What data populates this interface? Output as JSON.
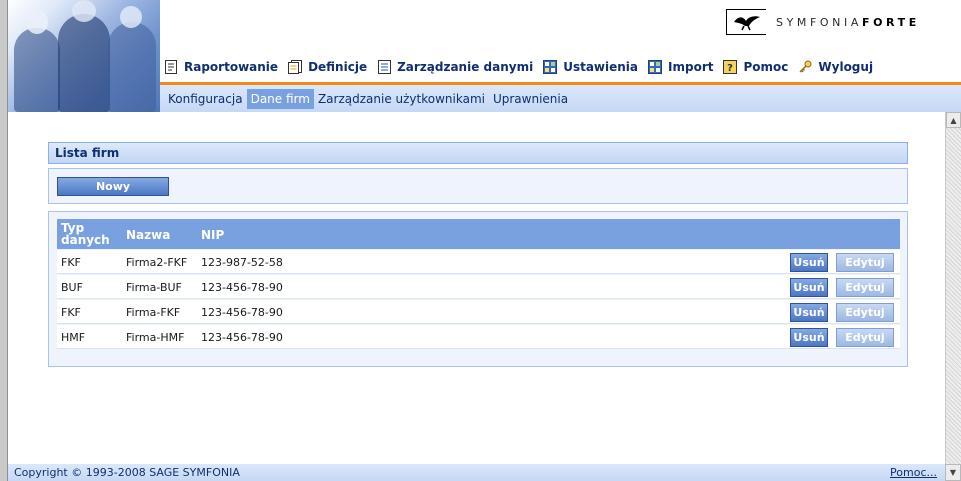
{
  "brand": {
    "logo_name": "SYMFONIA",
    "logo_suffix": "FORTE"
  },
  "menu": [
    {
      "label": "Raportowanie",
      "icon": "report-icon"
    },
    {
      "label": "Definicje",
      "icon": "definitions-icon"
    },
    {
      "label": "Zarządzanie danymi",
      "icon": "data-management-icon"
    },
    {
      "label": "Ustawienia",
      "icon": "settings-icon"
    },
    {
      "label": "Import",
      "icon": "import-icon"
    },
    {
      "label": "Pomoc",
      "icon": "help-icon"
    },
    {
      "label": "Wyloguj",
      "icon": "logout-key-icon"
    }
  ],
  "submenu": [
    {
      "label": "Konfiguracja",
      "active": false
    },
    {
      "label": "Dane firm",
      "active": true
    },
    {
      "label": "Zarządzanie użytkownikami",
      "active": false
    },
    {
      "label": "Uprawnienia",
      "active": false
    }
  ],
  "panel": {
    "title": "Lista firm",
    "new_button": "Nowy"
  },
  "table": {
    "headers": {
      "typ": "Typ danych",
      "nazwa": "Nazwa",
      "nip": "NIP"
    },
    "delete_label": "Usuń",
    "edit_label": "Edytuj",
    "rows": [
      {
        "typ": "FKF",
        "nazwa": "Firma2-FKF",
        "nip": "123-987-52-58"
      },
      {
        "typ": "BUF",
        "nazwa": "Firma-BUF",
        "nip": "123-456-78-90"
      },
      {
        "typ": "FKF",
        "nazwa": "Firma-FKF",
        "nip": "123-456-78-90"
      },
      {
        "typ": "HMF",
        "nazwa": "Firma-HMF",
        "nip": "123-456-78-90"
      }
    ]
  },
  "footer": {
    "copyright": "Copyright © 1993-2008 SAGE SYMFONIA",
    "help_link": "Pomoc..."
  },
  "colors": {
    "accent_orange": "#f28a18",
    "header_blue": "#7aa1df",
    "text_navy": "#0f2f70"
  }
}
